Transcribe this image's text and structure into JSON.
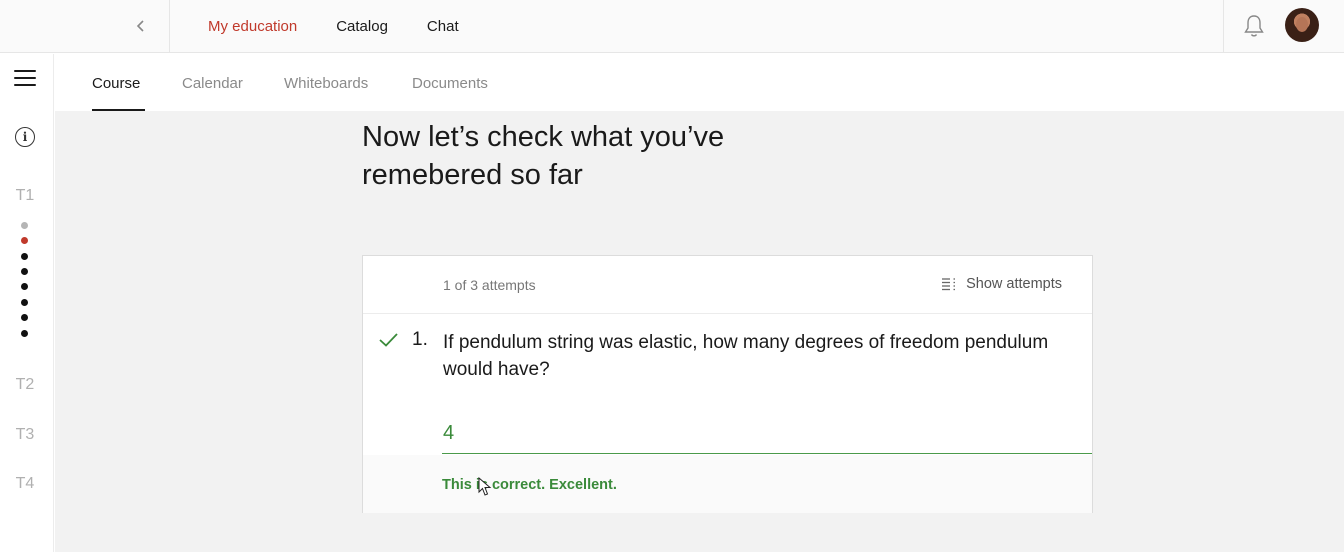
{
  "topbar": {
    "nav": [
      {
        "label": "My education",
        "active": true
      },
      {
        "label": "Catalog",
        "active": false
      },
      {
        "label": "Chat",
        "active": false
      }
    ],
    "icons": {
      "back": "chevron-left-icon",
      "notifications": "bell-icon",
      "profile": "avatar"
    }
  },
  "tabs": [
    {
      "label": "Course",
      "active": true
    },
    {
      "label": "Calendar",
      "active": false
    },
    {
      "label": "Whiteboards",
      "active": false
    },
    {
      "label": "Documents",
      "active": false
    }
  ],
  "rail": {
    "topics": [
      {
        "label": "T1",
        "expanded": true
      },
      {
        "label": "T2"
      },
      {
        "label": "T3"
      },
      {
        "label": "T4"
      }
    ],
    "t1_steps": [
      "visited",
      "current",
      "pending",
      "pending",
      "pending",
      "pending",
      "pending",
      "pending"
    ]
  },
  "main": {
    "heading_line1": "Now let’s check what you’ve",
    "heading_line2": "remebered so far"
  },
  "quiz": {
    "attempts_text": "1 of 3 attempts",
    "show_attempts_label": "Show attempts",
    "question_number": "1.",
    "question_text": "If pendulum string was elastic, how many degrees of freedom pendulum would have?",
    "answer_value": "4",
    "feedback": "This is correct. Excellent.",
    "status": "correct"
  },
  "colors": {
    "accent": "#c0392b",
    "correct": "#3a8a3a",
    "step_current": "#c0392b",
    "step_visited": "#b5b5b5"
  }
}
